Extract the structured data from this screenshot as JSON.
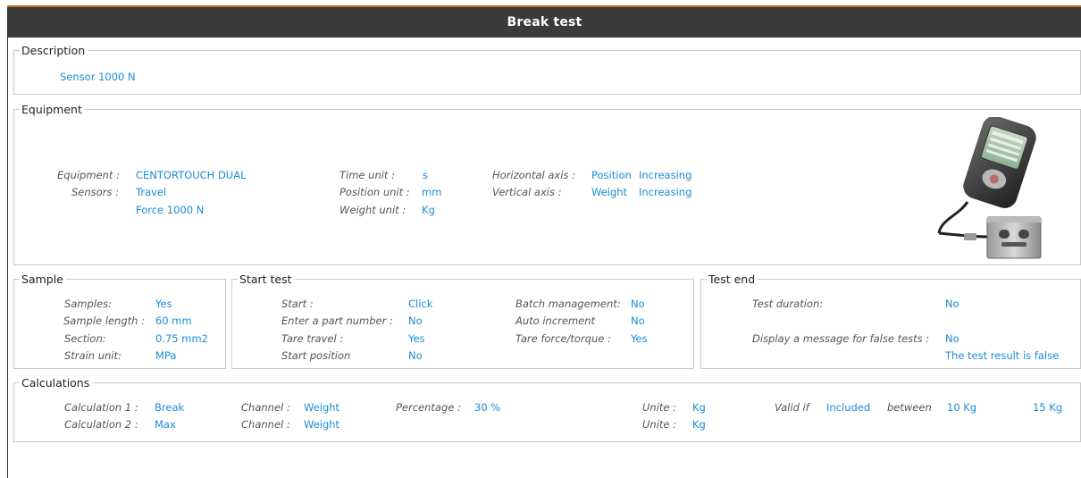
{
  "title": "Break test",
  "description": {
    "legend": "Description",
    "text": "Sensor 1000 N"
  },
  "equipment": {
    "legend": "Equipment",
    "equipment_label": "Equipment :",
    "equipment_value": "CENTORTOUCH DUAL",
    "sensors_label": "Sensors :",
    "sensor_1": "Travel",
    "sensor_2": "Force 1000 N",
    "time_unit_label": "Time unit :",
    "time_unit_value": "s",
    "position_unit_label": "Position unit :",
    "position_unit_value": "mm",
    "weight_unit_label": "Weight unit :",
    "weight_unit_value": "Kg",
    "horizontal_axis_label": "Horizontal axis :",
    "horizontal_axis_value": "Position",
    "horizontal_axis_dir": "Increasing",
    "vertical_axis_label": "Vertical axis :",
    "vertical_axis_value": "Weight",
    "vertical_axis_dir": "Increasing"
  },
  "sample": {
    "legend": "Sample",
    "samples_label": "Samples:",
    "samples_value": "Yes",
    "length_label": "Sample length :",
    "length_value": "60 mm",
    "section_label": "Section:",
    "section_value": "0.75 mm2",
    "strain_label": "Strain unit:",
    "strain_value": "MPa"
  },
  "start_test": {
    "legend": "Start test",
    "start_label": "Start :",
    "start_value": "Click",
    "part_label": "Enter a part number :",
    "part_value": "No",
    "tare_travel_label": "Tare travel :",
    "tare_travel_value": "Yes",
    "start_pos_label": "Start position",
    "start_pos_value": "No",
    "batch_label": "Batch management:",
    "batch_value": "No",
    "auto_label": "Auto increment",
    "auto_value": "No",
    "tare_force_label": "Tare force/torque :",
    "tare_force_value": "Yes"
  },
  "test_end": {
    "legend": "Test end",
    "duration_label": "Test duration:",
    "duration_value": "No",
    "false_msg_label": "Display a message for false tests :",
    "false_msg_value": "No",
    "false_msg_text": "The test result is false"
  },
  "calculations": {
    "legend": "Calculations",
    "rows": [
      {
        "calc_label": "Calculation 1 :",
        "calc_value": "Break",
        "channel_label": "Channel :",
        "channel_value": "Weight",
        "percentage_label": "Percentage :",
        "percentage_value": "30 %",
        "unite_label": "Unite :",
        "unite_value": "Kg",
        "valid_label": "Valid if",
        "valid_value": "Included",
        "between_label": "between",
        "min_value": "10 Kg",
        "max_value": "15 Kg"
      },
      {
        "calc_label": "Calculation 2 :",
        "calc_value": "Max",
        "channel_label": "Channel :",
        "channel_value": "Weight",
        "unite_label": "Unite :",
        "unite_value": "Kg"
      }
    ]
  },
  "colors": {
    "title_bar": "#3b3b3b",
    "value_text": "#1a8bd8",
    "accent_line": "#c46a1e"
  }
}
